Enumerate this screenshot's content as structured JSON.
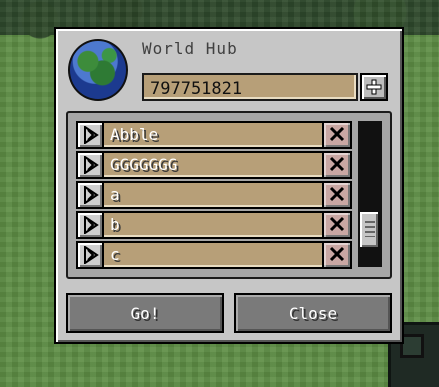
{
  "dialog": {
    "title": "World Hub",
    "seed_input": {
      "value": "797751821",
      "placeholder": ""
    }
  },
  "worlds": [
    {
      "name": "Abble"
    },
    {
      "name": "GGGGGGG"
    },
    {
      "name": "a"
    },
    {
      "name": "b"
    },
    {
      "name": "c"
    }
  ],
  "scrollbar": {
    "position_fraction": 0.78
  },
  "actions": {
    "go_label": "Go!",
    "close_label": "Close"
  },
  "icons": {
    "globe": "world-globe-icon",
    "add": "plus-icon",
    "play": "play-triangle-icon",
    "delete": "x-icon"
  }
}
